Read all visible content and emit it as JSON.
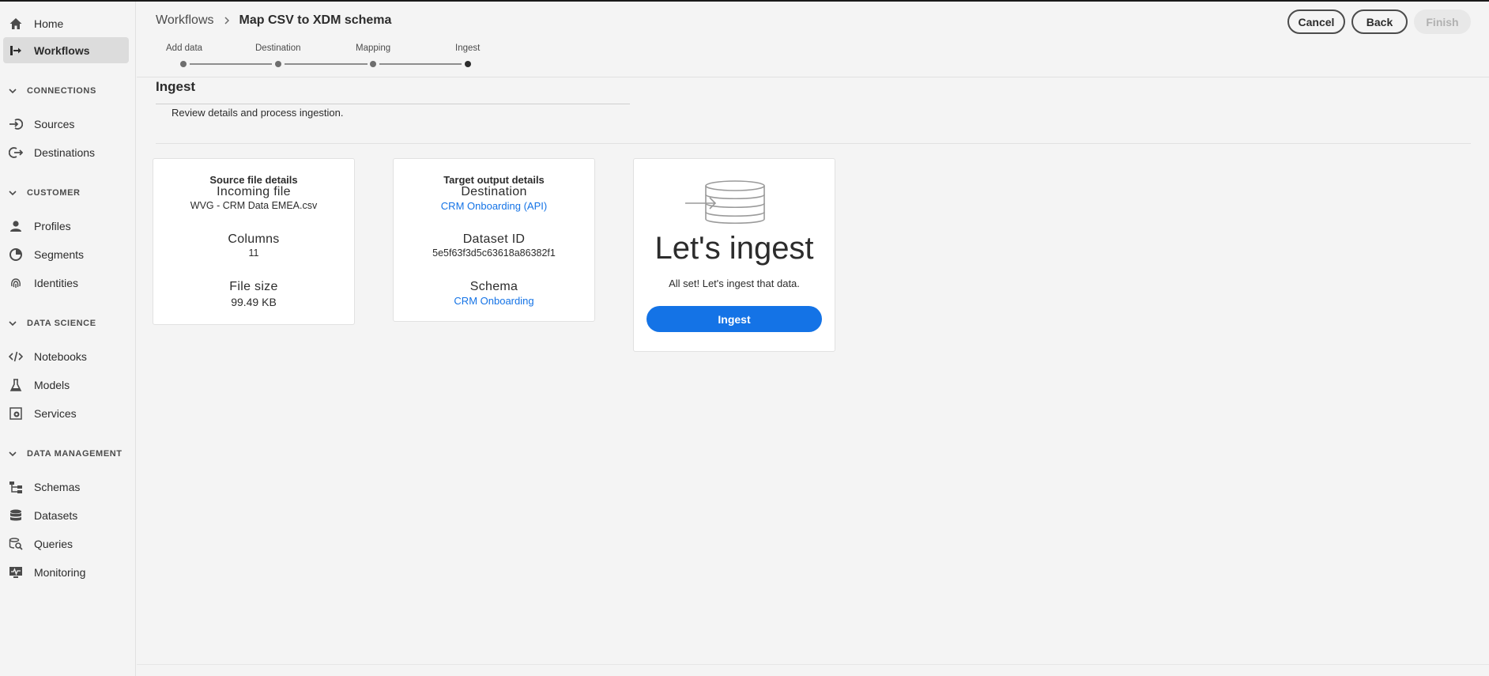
{
  "sidebar": {
    "top_items": [
      {
        "label": "Home",
        "icon": "home-icon"
      },
      {
        "label": "Workflows",
        "icon": "workflow-icon",
        "active": true
      }
    ],
    "sections": [
      {
        "title": "CONNECTIONS",
        "items": [
          {
            "label": "Sources",
            "icon": "source-icon"
          },
          {
            "label": "Destinations",
            "icon": "destination-icon"
          }
        ]
      },
      {
        "title": "CUSTOMER",
        "items": [
          {
            "label": "Profiles",
            "icon": "user-icon"
          },
          {
            "label": "Segments",
            "icon": "segment-icon"
          },
          {
            "label": "Identities",
            "icon": "fingerprint-icon"
          }
        ]
      },
      {
        "title": "DATA SCIENCE",
        "items": [
          {
            "label": "Notebooks",
            "icon": "code-icon"
          },
          {
            "label": "Models",
            "icon": "beaker-icon"
          },
          {
            "label": "Services",
            "icon": "gear-box-icon"
          }
        ]
      },
      {
        "title": "DATA MANAGEMENT",
        "items": [
          {
            "label": "Schemas",
            "icon": "schema-icon"
          },
          {
            "label": "Datasets",
            "icon": "database-icon"
          },
          {
            "label": "Queries",
            "icon": "query-icon"
          },
          {
            "label": "Monitoring",
            "icon": "monitor-icon"
          }
        ]
      }
    ]
  },
  "header": {
    "breadcrumb_root": "Workflows",
    "breadcrumb_current": "Map CSV to XDM schema",
    "buttons": {
      "cancel": "Cancel",
      "back": "Back",
      "finish": "Finish"
    },
    "steps": [
      {
        "label": "Add data"
      },
      {
        "label": "Destination"
      },
      {
        "label": "Mapping"
      },
      {
        "label": "Ingest",
        "current": true
      }
    ]
  },
  "main": {
    "title": "Ingest",
    "subtitle": "Review details and process ingestion.",
    "source_card": {
      "heading": "Source file details",
      "incoming_label": "Incoming file",
      "incoming_value": "WVG - CRM Data EMEA.csv",
      "columns_label": "Columns",
      "columns_value": "11",
      "size_label": "File size",
      "size_value": "99.49 KB"
    },
    "target_card": {
      "heading": "Target output details",
      "destination_label": "Destination",
      "destination_value": "CRM Onboarding (API)",
      "dataset_label": "Dataset ID",
      "dataset_value": "5e5f63f3d5c63618a86382f1",
      "schema_label": "Schema",
      "schema_value": "CRM Onboarding"
    },
    "ingest_card": {
      "title": "Let's ingest",
      "message": "All set! Let's ingest that data.",
      "button": "Ingest",
      "accent": "#1473e6"
    }
  }
}
